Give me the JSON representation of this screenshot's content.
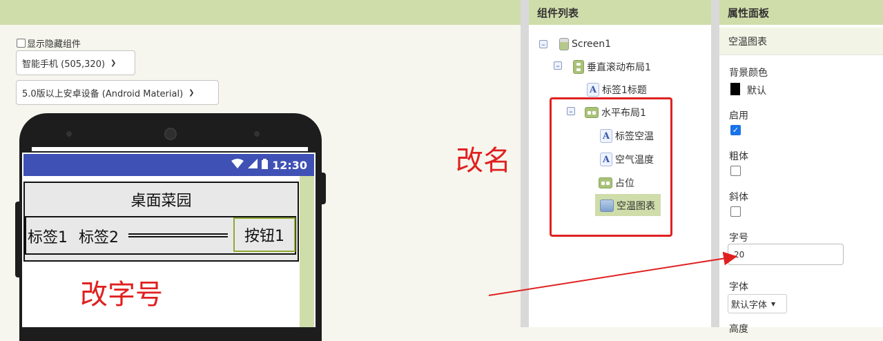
{
  "viewer": {
    "show_hidden_label": "显示隐藏组件",
    "device_select": "智能手机 (505,320)",
    "theme_select": "5.0版以上安卓设备 (Android Material)",
    "status_time": "12:30",
    "title_label_text": "桌面菜园",
    "label1_text": "标签1",
    "label2_text": "标签2",
    "button1_text": "按钮1"
  },
  "annotations": {
    "rename": "改名",
    "change_font_size": "改字号"
  },
  "components": {
    "title": "组件列表",
    "items": [
      {
        "label": "Screen1",
        "icon": "screen-icon"
      },
      {
        "label": "垂直滚动布局1",
        "icon": "vertical-scroll-arrangement-icon"
      },
      {
        "label": "标签1标题",
        "icon": "label-icon"
      },
      {
        "label": "水平布局1",
        "icon": "horizontal-arrangement-icon"
      },
      {
        "label": "标签空温",
        "icon": "label-icon"
      },
      {
        "label": "空气温度",
        "icon": "label-icon"
      },
      {
        "label": "占位",
        "icon": "horizontal-arrangement-icon"
      },
      {
        "label": "空温图表",
        "icon": "chart-icon",
        "selected": true
      }
    ]
  },
  "properties": {
    "title": "属性面板",
    "component_name": "空温图表",
    "background_color_label": "背景颜色",
    "background_color_value": "默认",
    "enabled_label": "启用",
    "enabled": true,
    "bold_label": "粗体",
    "bold": false,
    "italic_label": "斜体",
    "italic": false,
    "font_size_label": "字号",
    "font_size_value": "20",
    "font_label": "字体",
    "font_value": "默认字体",
    "height_label_partial": "高度"
  },
  "colors": {
    "header_green": "#cfddaa",
    "annotation_red": "#e02020",
    "status_bar_blue": "#3f51b5"
  }
}
